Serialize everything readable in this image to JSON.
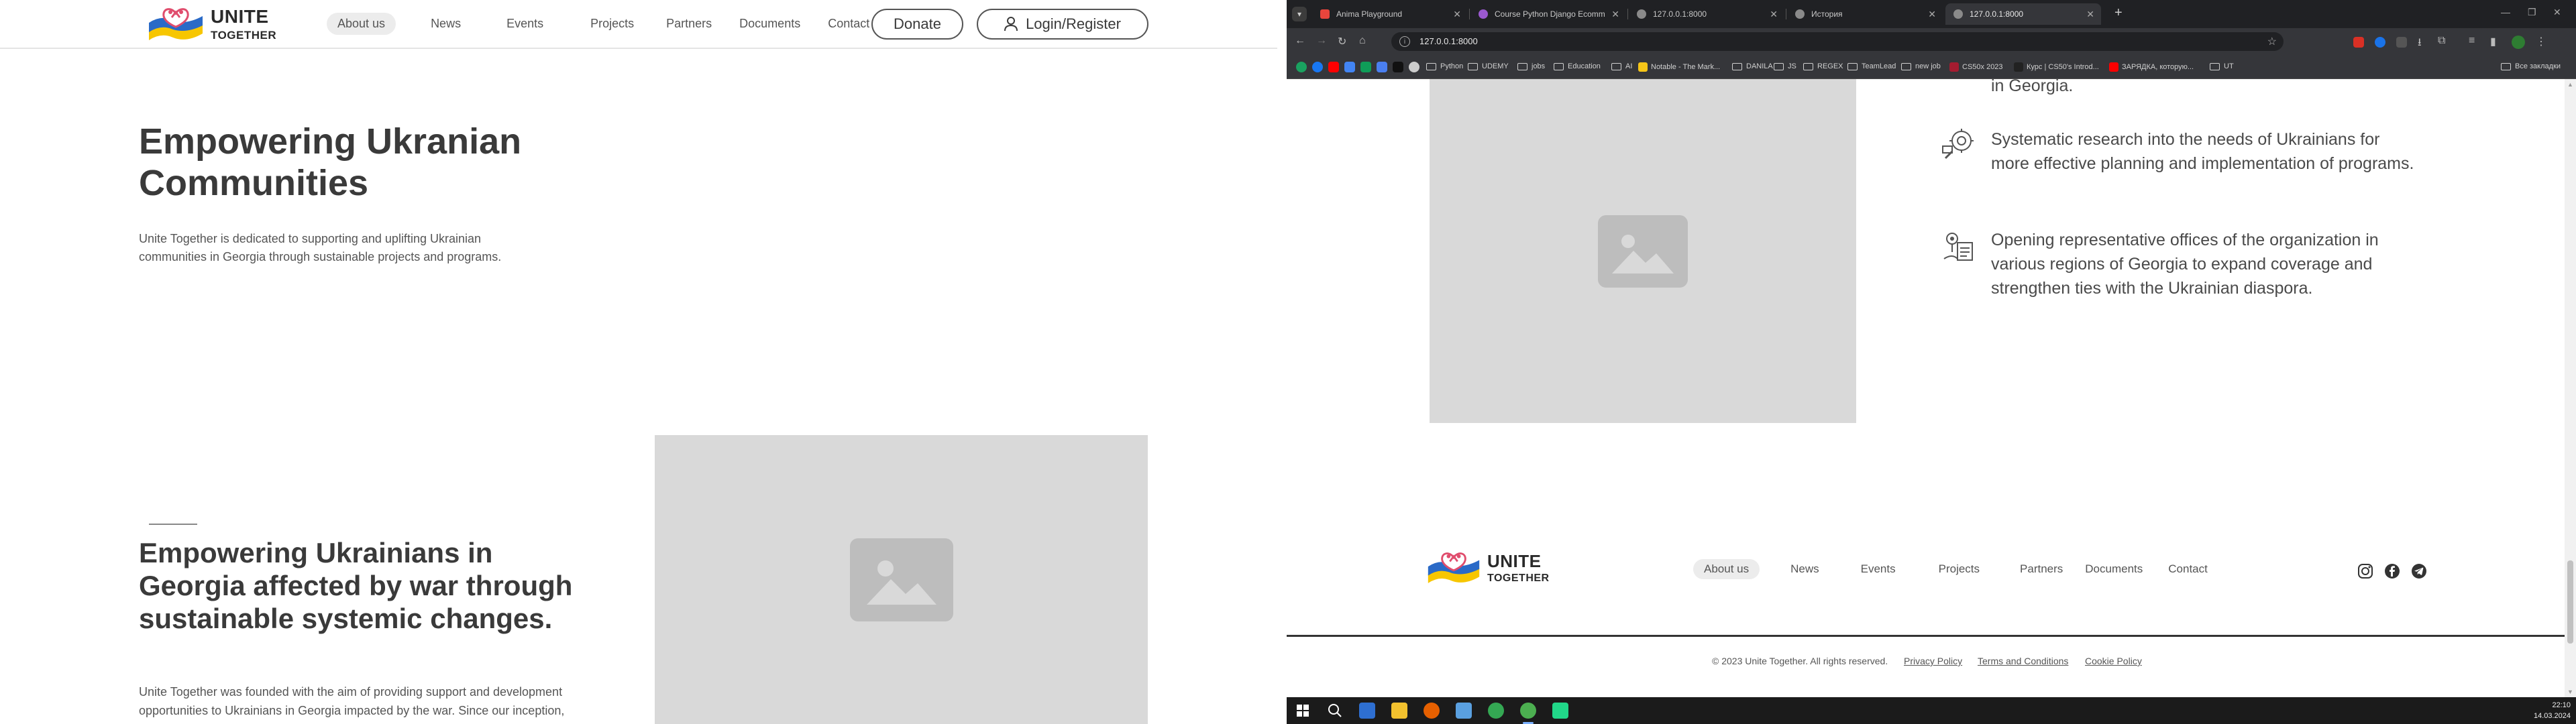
{
  "site": {
    "brand_line1": "UNITE",
    "brand_line2": "TOGETHER",
    "nav": [
      "About us",
      "News",
      "Events",
      "Projects",
      "Partners",
      "Documents",
      "Contact"
    ],
    "donate_label": "Donate",
    "login_label": "Login/Register"
  },
  "hero": {
    "title": "Empowering Ukranian Communities",
    "text": "Unite Together is dedicated to supporting and uplifting Ukrainian communities in Georgia through sustainable projects and programs."
  },
  "section": {
    "title": "Empowering Ukrainians in Georgia affected by war through sustainable systemic changes.",
    "text": "Unite Together was founded with the aim of providing support and development opportunities to Ukrainians in Georgia impacted by the war. Since our inception,"
  },
  "browser": {
    "tabs": [
      {
        "title": "Anima Playground",
        "color": "#e8453c"
      },
      {
        "title": "Course Python Django Ecomm",
        "color": "#9b59d0"
      },
      {
        "title": "127.0.0.1:8000",
        "color": "#8a8a8a"
      },
      {
        "title": "История",
        "color": "#8a8a8a"
      },
      {
        "title": "127.0.0.1:8000",
        "color": "#8a8a8a"
      }
    ],
    "url": "127.0.0.1:8000",
    "bookmarks": [
      "Python",
      "UDEMY",
      "jobs",
      "Education",
      "AI",
      "Notable - The Mark...",
      "DANILA",
      "JS",
      "REGEX",
      "TeamLead",
      "new job",
      "CS50x 2023",
      "Курс | CS50's Introd...",
      "ЗАРЯДКА, которую...",
      "UT"
    ],
    "all_bookmarks": "Все закладки"
  },
  "features": [
    {
      "text": "in Georgia."
    },
    {
      "text": "Systematic research into the needs of Ukrainians for more effective planning and implementation of programs."
    },
    {
      "text": "Opening representative offices of the organization in various regions of Georgia to expand coverage and strengthen ties with the Ukrainian diaspora."
    }
  ],
  "footer": {
    "copyright": "© 2023 Unite Together. All rights reserved.",
    "privacy": "Privacy Policy",
    "terms": "Terms and Conditions",
    "cookie": "Cookie Policy"
  },
  "taskbar": {
    "time": "22:10",
    "date": "14.03.2024"
  }
}
